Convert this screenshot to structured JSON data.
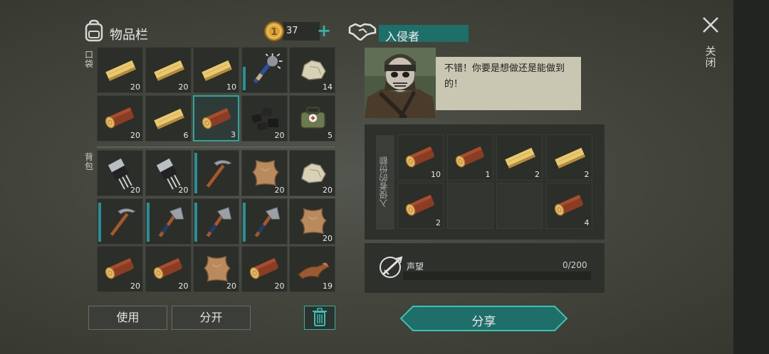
{
  "inventory": {
    "title": "物品栏",
    "coins": "37",
    "pocket_label": "口袋",
    "backpack_label": "背包",
    "pocket_slots": [
      {
        "item": "wood-plank",
        "qty": "20"
      },
      {
        "item": "wood-plank",
        "qty": "20"
      },
      {
        "item": "wood-plank",
        "qty": "10"
      },
      {
        "item": "spiked-club",
        "qty": "",
        "durability": 0.55
      },
      {
        "item": "stone",
        "qty": "14"
      },
      {
        "item": "log",
        "qty": "20"
      },
      {
        "item": "wood-plank",
        "qty": "6"
      },
      {
        "item": "log",
        "qty": "3",
        "selected": true
      },
      {
        "item": "coal",
        "qty": "20"
      },
      {
        "item": "first-aid-bag",
        "qty": "5"
      }
    ],
    "backpack_slots": [
      {
        "item": "transistor",
        "qty": "20"
      },
      {
        "item": "transistor",
        "qty": "20"
      },
      {
        "item": "pickaxe",
        "qty": "",
        "durability": 0.95
      },
      {
        "item": "leather-hide",
        "qty": "20"
      },
      {
        "item": "stone",
        "qty": "20"
      },
      {
        "item": "pickaxe",
        "qty": "",
        "durability": 0.92
      },
      {
        "item": "hatchet",
        "qty": "",
        "durability": 0.92
      },
      {
        "item": "hatchet",
        "qty": "",
        "durability": 0.92
      },
      {
        "item": "hatchet",
        "qty": "",
        "durability": 0.92
      },
      {
        "item": "leather-hide",
        "qty": "20"
      },
      {
        "item": "log",
        "qty": "20"
      },
      {
        "item": "log",
        "qty": "20"
      },
      {
        "item": "leather-hide",
        "qty": "20"
      },
      {
        "item": "log",
        "qty": "20"
      },
      {
        "item": "leather-scrap",
        "qty": "19"
      }
    ],
    "use_label": "使用",
    "split_label": "分开"
  },
  "trader": {
    "name": "入侵者",
    "dialog": "不错！你要是想做还是能做到的！",
    "quota_label": "入侵者的份额",
    "quota_slots": [
      {
        "item": "log",
        "qty": "10"
      },
      {
        "item": "log",
        "qty": "1"
      },
      {
        "item": "wood-plank",
        "qty": "2"
      },
      {
        "item": "wood-plank",
        "qty": "2"
      },
      {
        "item": "log",
        "qty": "2"
      },
      {
        "item": "",
        "qty": ""
      },
      {
        "item": "",
        "qty": ""
      },
      {
        "item": "log",
        "qty": "4"
      }
    ],
    "reputation_label": "声望",
    "reputation_value": "0/200",
    "share_label": "分享"
  },
  "close_label": "关闭",
  "colors": {
    "accent": "#2fa49a",
    "bubble": "#c9c7b2",
    "coin": "#d8a23a"
  }
}
